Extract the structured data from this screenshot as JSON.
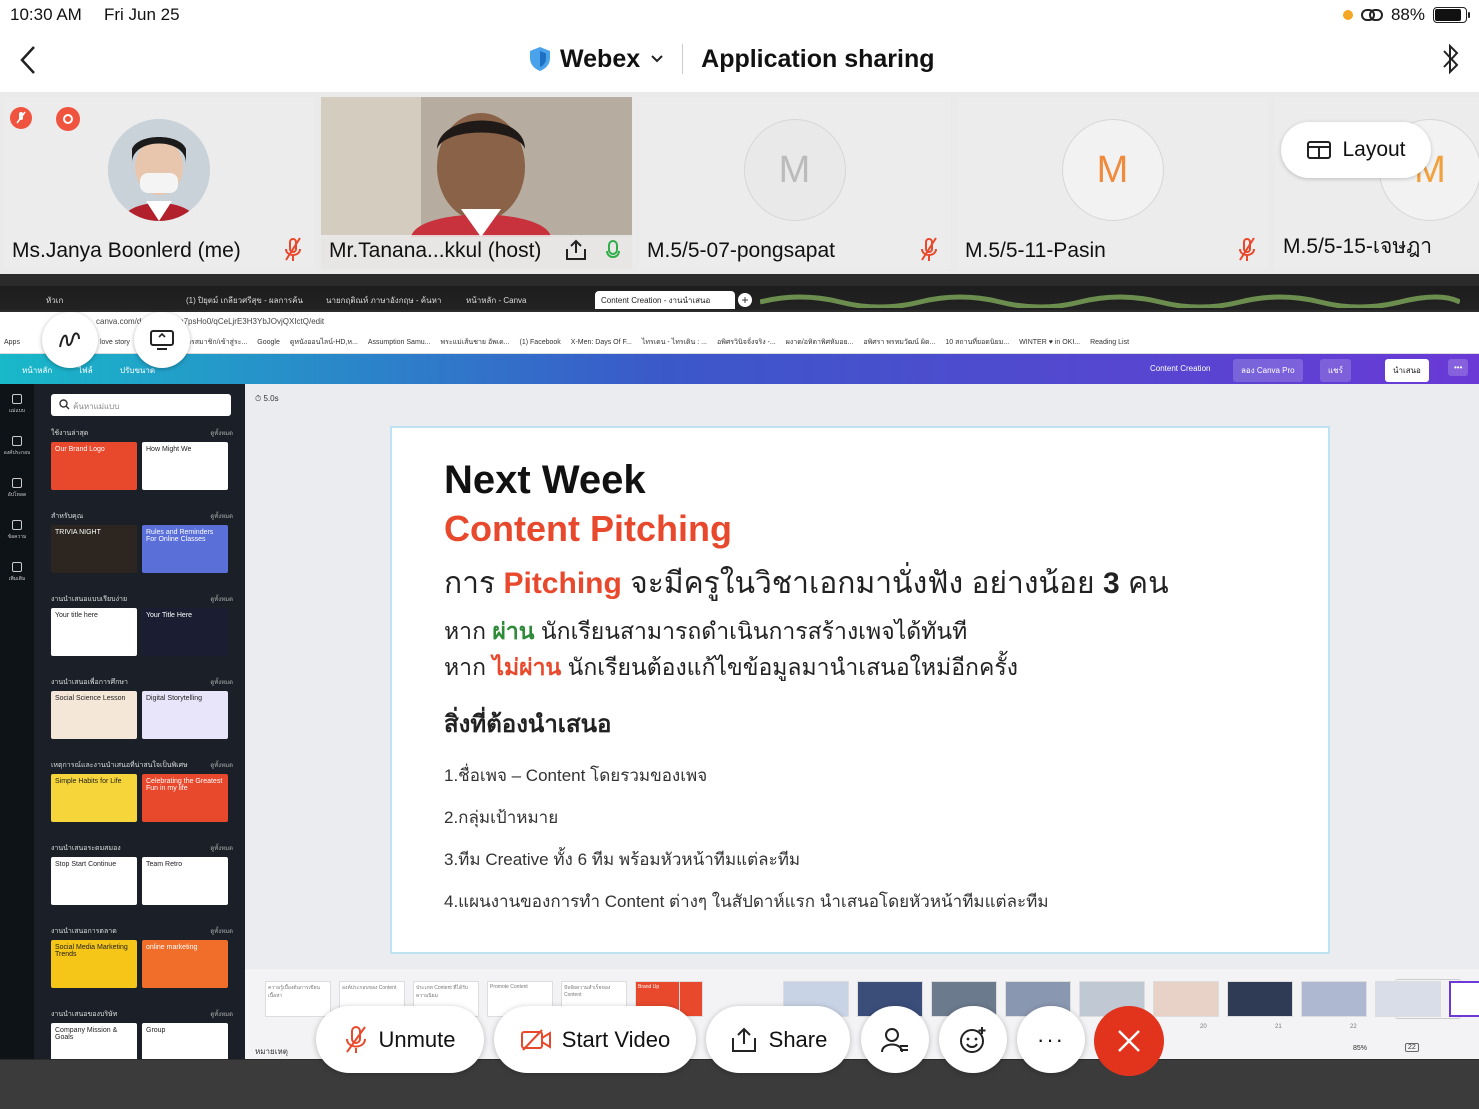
{
  "status": {
    "time": "10:30 AM",
    "date": "Fri Jun 25",
    "battery": "88%",
    "battery_level": 0.88
  },
  "header": {
    "app": "Webex",
    "title": "Application sharing"
  },
  "participants": [
    {
      "name": "Ms.Janya Boonlerd (me)",
      "muted": true
    },
    {
      "name": "Mr.Tanana...kkul (host)",
      "muted": false
    },
    {
      "name": "M.5/5-07-pongsapat",
      "initial": "M",
      "muted": true
    },
    {
      "name": "M.5/5-11-Pasin",
      "initial": "M",
      "muted": true
    },
    {
      "name": "M.5/5-15-เจษฎา",
      "initial": "M"
    }
  ],
  "layout_label": "Layout",
  "browser": {
    "tabs": [
      "หัวเก",
      "(1) ปิยุตม์ เกลียวศรีสุข - ผลการค้น",
      "นายกฤติณห์ ภาษาอังกฤษ - ค้นหา",
      "หน้าหลัก - Canva",
      "Content Creation - งานนำเสนอ"
    ],
    "url": "canva.com/design/DAEn7psHo0/qCeLjrE3H3YbJOvjQXIctQ/edit",
    "bookmarks": [
      "Apps",
      "love story",
      "YouTube",
      "สมัครสมาชิก/เข้าสู่ระ...",
      "Google",
      "ดูหนังออนไลน์-HD,ห...",
      "Assumption Samu...",
      "พระแม่เส้นชาย อัพเด...",
      "(1) Facebook",
      "X-Men: Days Of F...",
      "ไทรเดน - ไทรเดิน : ...",
      "อพิศรวินิจจั่งจริง -...",
      "ผงาด/อหิดาพิศหัมอย...",
      "อพิศรา พรหมวัฒน์ ผิด...",
      "10 สถานที่ยอดนิยม...",
      "WINTER ♥ in OKI...",
      "Reading List"
    ]
  },
  "canva": {
    "menu": [
      "หน้าหลัก",
      "ไฟล์",
      "ปรับขนาด"
    ],
    "doc_title": "Content Creation",
    "try_pro": "ลอง Canva Pro",
    "share": "แชร์",
    "present": "นำเสนอ",
    "timer": "5.0s",
    "search_placeholder": "ค้นหาแม่แบบ",
    "sidebar": [
      "แม่แบบ",
      "องค์ประกอบ",
      "อัปโหลด",
      "ข้อความ",
      "เพิ่มเติม"
    ],
    "see_all": "ดูทั้งหมด",
    "sections": [
      {
        "title": "ใช้งานล่าสุด",
        "cards": [
          "Our Brand Logo",
          "How Might We"
        ]
      },
      {
        "title": "สำหรับคุณ",
        "cards": [
          "TRIVIA NIGHT",
          "Rules and Reminders For Online Classes"
        ]
      },
      {
        "title": "งานนำเสนอแบบเรียบง่าย",
        "cards": [
          "Your title here",
          "Your Title Here"
        ]
      },
      {
        "title": "งานนำเสนอเพื่อการศึกษา",
        "cards": [
          "Social Science Lesson",
          "Digital Storytelling"
        ]
      },
      {
        "title": "เหตุการณ์และงานนำเสนอที่น่าสนใจเป็นพิเศษ",
        "cards": [
          "Simple Habits for Life",
          "Celebrating the Greatest Fun in my life"
        ]
      },
      {
        "title": "งานนำเสนอระดมสมอง",
        "cards": [
          "Stop Start Continue",
          "Team Retro"
        ]
      },
      {
        "title": "งานนำเสนอการตลาด",
        "cards": [
          "Social Media Marketing Trends",
          "online marketing"
        ]
      },
      {
        "title": "งานนำเสนอของบริษัท",
        "cards": [
          "Company Mission & Goals",
          "Group"
        ]
      }
    ],
    "notes": "หมายเหตุ",
    "zoom": "85%",
    "page_numbers": [
      "20",
      "21",
      "22"
    ],
    "page_count": "22"
  },
  "slide": {
    "title": "Next Week",
    "subtitle": "Content Pitching",
    "line1_a": "การ ",
    "line1_b": "Pitching",
    "line1_c": " จะมีครูในวิชาเอกมานั่งฟัง อย่างน้อย ",
    "line1_d": "3",
    "line1_e": " คน",
    "line2_a": "หาก ",
    "line2_b": "ผ่าน",
    "line2_c": " นักเรียนสามารถดำเนินการสร้างเพจได้ทันที",
    "line3_a": "หาก ",
    "line3_b": "ไม่ผ่าน",
    "line3_c": " นักเรียนต้องแก้ไขข้อมูลมานำเสนอใหม่อีกครั้ง",
    "heading": "สิ่งที่ต้องนำเสนอ",
    "items": [
      "1.ชื่อเพจ – Content โดยรวมของเพจ",
      "2.กลุ่มเป้าหมาย",
      "3.ทีม Creative ทั้ง 6 ทีม พร้อมหัวหน้าทีมแต่ละทีม",
      "4.แผนงานของการทำ Content ต่างๆ ในสัปดาห์แรก นำเสนอโดยหัวหน้าทีมแต่ละทีม"
    ]
  },
  "thumbnails": [
    "ความรู้เบื้องต้นการเขียนเนื้อหา",
    "องค์ประกอบของ Content",
    "ประเภท Content ที่ได้รับความนิยม",
    "Promote Content",
    "ปัจจัยความสำเร็จของ Content",
    "Brand Up"
  ],
  "controls": {
    "unmute": "Unmute",
    "video": "Start Video",
    "share": "Share"
  },
  "colors": {
    "accent_red": "#e8492d",
    "end_call": "#e2341d",
    "green": "#2f8a3a"
  }
}
